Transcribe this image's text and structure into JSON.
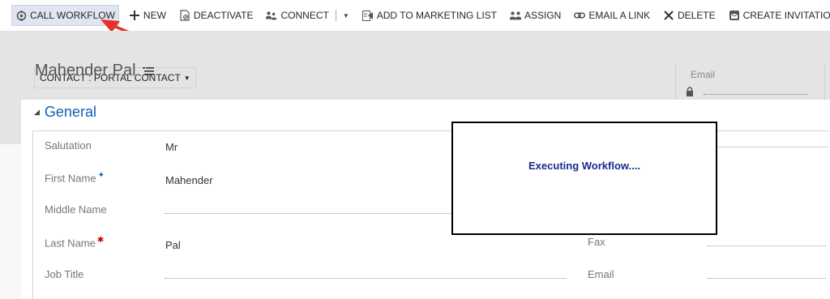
{
  "toolbar": {
    "call_workflow": "CALL WORKFLOW",
    "new": "NEW",
    "deactivate": "DEACTIVATE",
    "connect": "CONNECT",
    "add_to_marketing_list": "ADD TO MARKETING LIST",
    "assign": "ASSIGN",
    "email_a_link": "EMAIL A LINK",
    "delete": "DELETE",
    "create_invitation": "CREATE INVITATION",
    "more": "•••"
  },
  "header": {
    "form_selector": "CONTACT : PORTAL CONTACT",
    "record_name": "Mahender Pal",
    "email_label": "Email"
  },
  "section": {
    "title": "General"
  },
  "fields": {
    "salutation": {
      "label": "Salutation",
      "value": "Mr"
    },
    "first_name": {
      "label": "First Name",
      "value": "Mahender"
    },
    "middle_name": {
      "label": "Middle Name",
      "value": ""
    },
    "last_name": {
      "label": "Last Name",
      "value": "Pal"
    },
    "job_title": {
      "label": "Job Title",
      "value": ""
    },
    "fax": {
      "label": "Fax",
      "value": ""
    },
    "email": {
      "label": "Email",
      "value": ""
    }
  },
  "dialog": {
    "message": "Executing Workflow...."
  },
  "colors": {
    "accent_blue": "#1160b7",
    "dialog_text": "#1a2a8c",
    "required_red": "#cc0000",
    "header_gray": "#e4e4e4",
    "annotation_red": "#e8312a"
  },
  "icons": [
    "workflow-icon",
    "plus-icon",
    "deactivate-icon",
    "connect-icon",
    "marketing-list-icon",
    "assign-icon",
    "link-icon",
    "delete-icon",
    "invitation-icon",
    "lock-icon",
    "list-icon",
    "collapse-triangle-icon"
  ]
}
